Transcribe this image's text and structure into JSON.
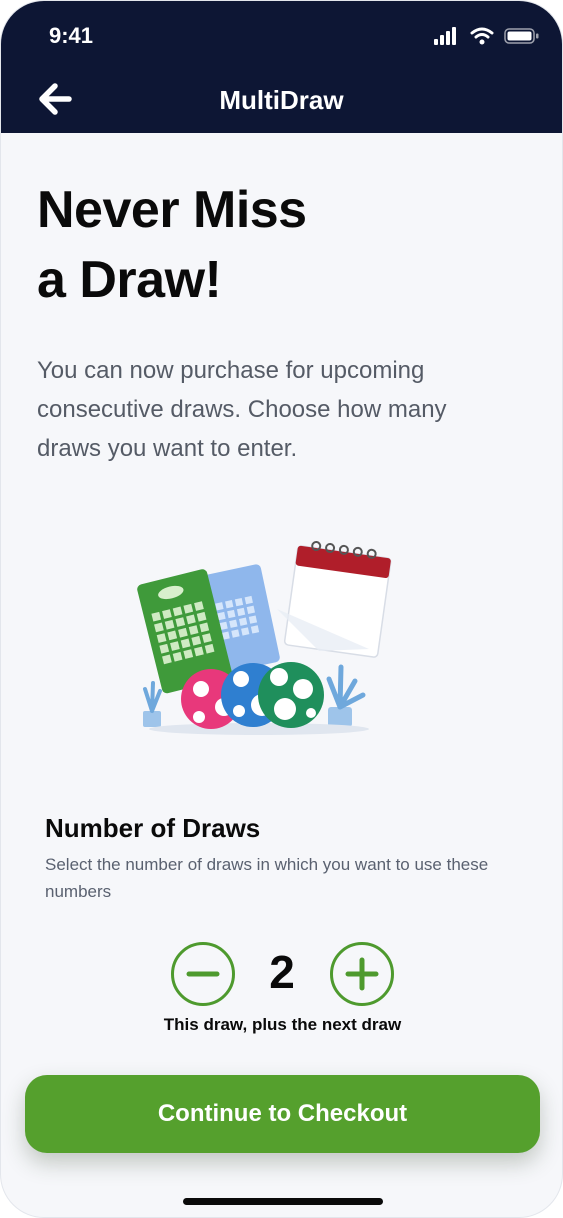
{
  "status_bar": {
    "time": "9:41",
    "icons": [
      "signal-icon",
      "wifi-icon",
      "battery-icon"
    ]
  },
  "header": {
    "title": "MultiDraw",
    "back_icon": "back-arrow-icon",
    "background": "#0d1634"
  },
  "hero": {
    "headline_line1": "Never Miss",
    "headline_line2": "a Draw!",
    "intro": "You can now purchase for upcoming consecutive draws. Choose how many draws you want to enter."
  },
  "illustration": {
    "icon": "lottery-tickets-balls-calendar-illustration"
  },
  "draws": {
    "title": "Number of Draws",
    "description": "Select the number of draws in which you want to use these numbers",
    "count": "2",
    "caption": "This draw, plus the next draw",
    "decrement_icon": "minus-icon",
    "increment_icon": "plus-icon"
  },
  "cta": {
    "label": "Continue to Checkout",
    "color": "#55a02d"
  },
  "colors": {
    "accent_green": "#4e9a2e",
    "background": "#f6f7fa"
  }
}
